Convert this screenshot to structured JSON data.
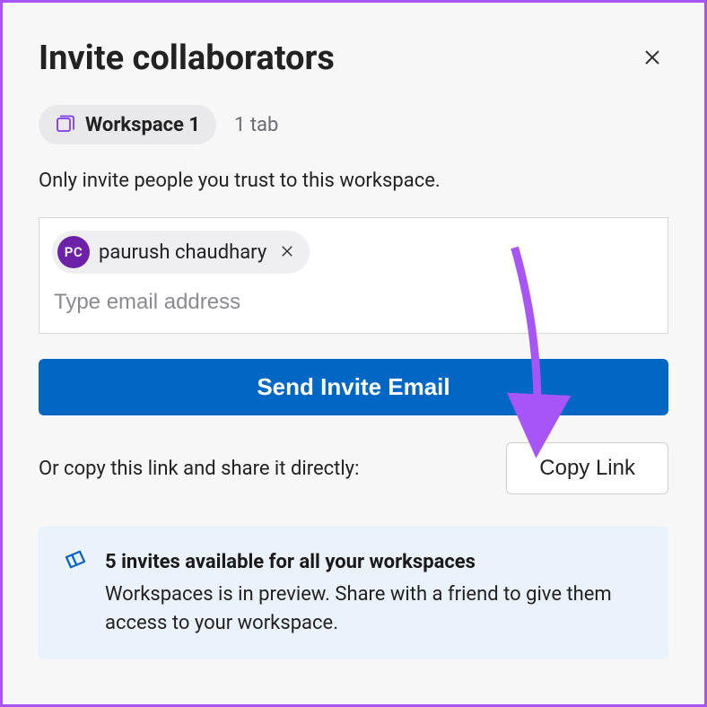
{
  "title": "Invite collaborators",
  "workspace": {
    "name": "Workspace 1",
    "tab_count_label": "1 tab"
  },
  "subtitle": "Only invite people you trust to this workspace.",
  "invite": {
    "people": [
      {
        "initials": "PC",
        "name": "paurush chaudhary"
      }
    ],
    "placeholder": "Type email address"
  },
  "send_button_label": "Send Invite Email",
  "copy": {
    "prompt": "Or copy this link and share it directly:",
    "button_label": "Copy Link"
  },
  "info": {
    "title": "5 invites available for all your workspaces",
    "desc": "Workspaces is in preview. Share with a friend to give them access to your workspace."
  },
  "colors": {
    "accent": "#0067c5",
    "avatar_bg": "#6b21a8",
    "annotation_arrow": "#a855f7"
  }
}
